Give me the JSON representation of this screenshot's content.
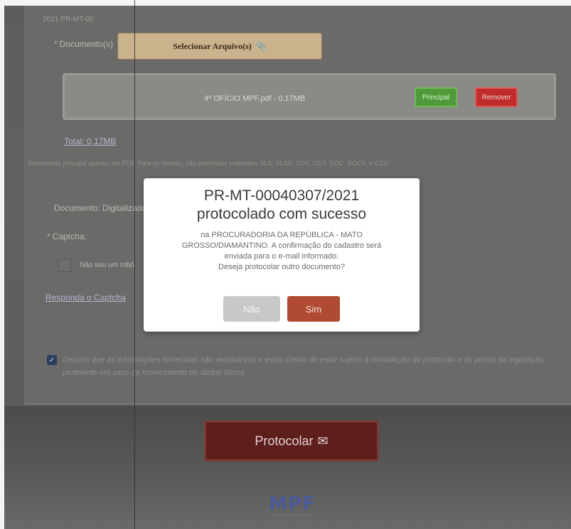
{
  "form": {
    "top_faint_label": "2021-PR-MT-00",
    "documents_label": "Documento(s)",
    "select_button_label": "Selecionar Arquivo(s)",
    "select_button_icon": "paperclip-icon",
    "file": {
      "name_size": "4º OFÍCIO MPF.pdf - 0,17MB",
      "principal_label": "Principal",
      "remove_label": "Remover"
    },
    "total": "Total: 0,17MB",
    "note": "Documento principal apenas em PDF. Para os demais, são permitidas extensões XLS, XLSX, ODS, ODT, DOC, DOCX, e CSV.",
    "document_type_label": "Documento: Digitalizado",
    "captcha_label": "Captcha:",
    "robot_label": "Não sou um robô",
    "captcha_link": "Responda o Captcha",
    "declaration": "Declaro que as informações fornecidas são verdadeiras e estou ciente de estar sujeito à invalidação do protocolo e às penas da legislação pertinente em caso de fornecimento de dados falsos.",
    "submit_label": "Protocolar",
    "submit_icon": "protocol-icon"
  },
  "footer": {
    "logo_text": "MPF",
    "logo_subtitle": "Ministério Público Federal"
  },
  "modal": {
    "title_line1": "PR-MT-00040307/2021",
    "title_line2": "protocolado com sucesso",
    "body_line1": "na PROCURADORIA DA REPÚBLICA - MATO",
    "body_line2": "GROSSO/DIAMANTINO. A confirmação do cadastro será",
    "body_line3": "enviada para o e-mail informado.",
    "body_line4": "Deseja protocolar outro documento?",
    "no_label": "Não",
    "yes_label": "Sim"
  },
  "colors": {
    "overlay": "#5e5e5c",
    "principal_button": "#4f9a3a",
    "remove_button": "#c02b2b",
    "submit_button": "#5d1e1c",
    "yes_button": "#b04a32",
    "no_button": "#c8c8c8"
  }
}
